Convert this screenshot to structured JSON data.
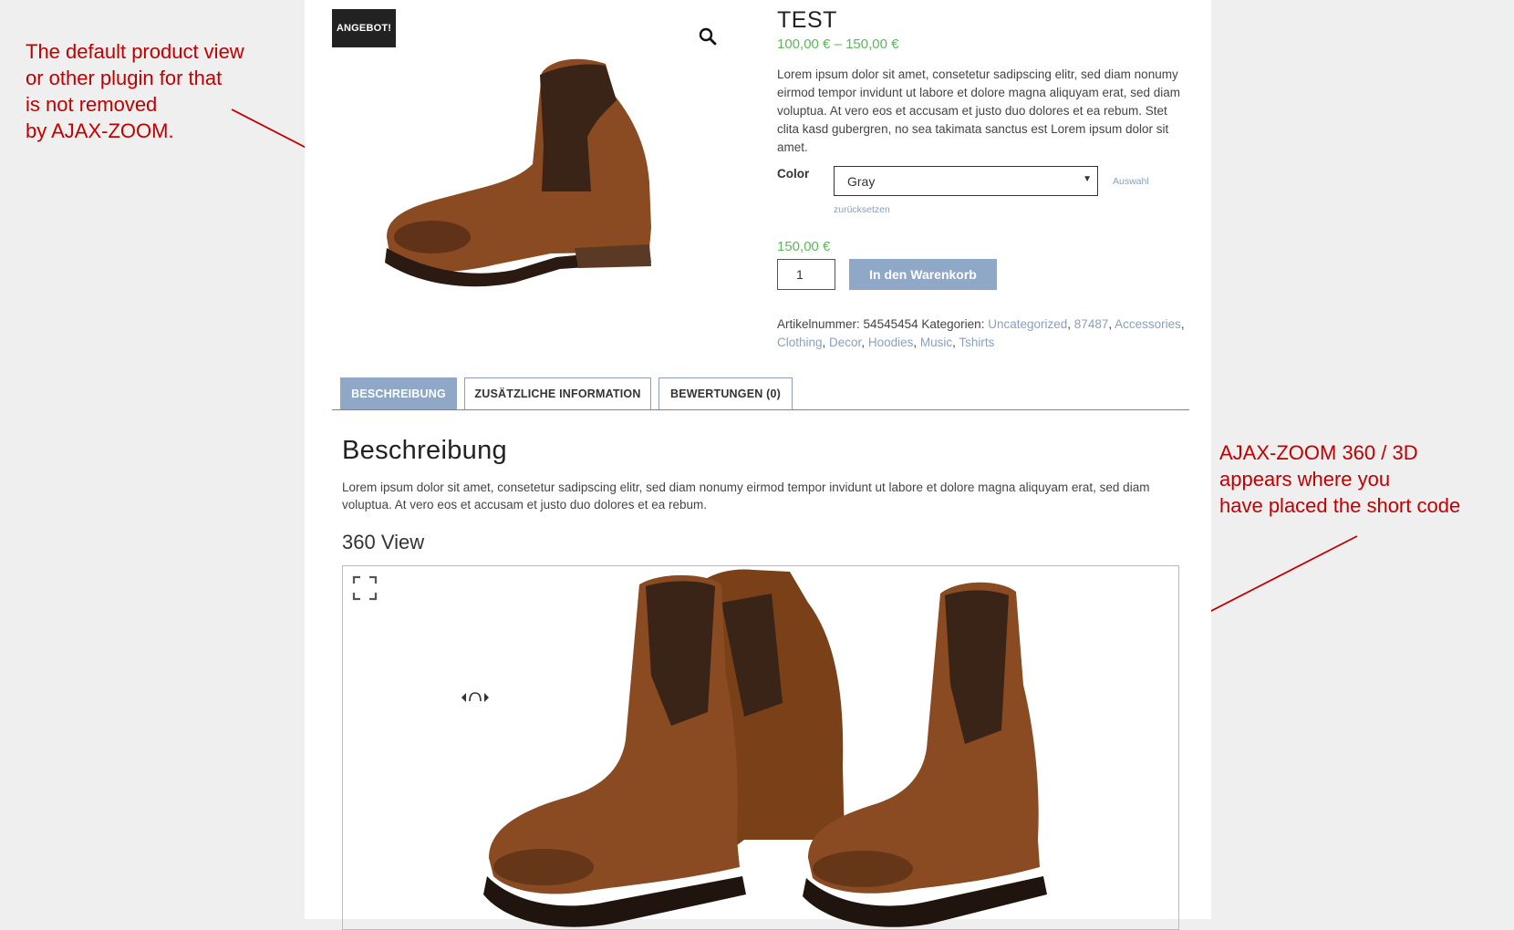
{
  "annotations": {
    "left": "The default product view\nor other plugin for that\nis not removed\nby AJAX-ZOOM.",
    "right": "AJAX-ZOOM 360 / 3D\nappears where you\nhave placed the short code",
    "color": "#c00000"
  },
  "gallery": {
    "sale_badge": "ANGEBOT!",
    "zoom_icon": "magnifier-icon",
    "image": "brown-chelsea-boot-single"
  },
  "product": {
    "title": "TEST",
    "price_range": "100,00 € – 150,00 €",
    "short_description": "Lorem ipsum dolor sit amet, consetetur sadipscing elitr, sed diam nonumy eirmod tempor invidunt ut labore et dolore magna aliquyam erat, sed diam voluptua. At vero eos et accusam et justo duo dolores et ea rebum. Stet clita kasd gubergren, no sea takimata sanctus est Lorem ipsum dolor sit amet.",
    "color_label": "Color",
    "color_value": "Gray",
    "reset_label_1": "Auswahl",
    "reset_label_2": "zurücksetzen",
    "price": "150,00 €",
    "quantity": "1",
    "add_to_cart": "In den Warenkorb",
    "price_color": "#5fb55a"
  },
  "meta": {
    "sku_label": "Artikelnummer:",
    "sku": "54545454",
    "categories_label": "Kategorien:",
    "categories": [
      "Uncategorized",
      "87487",
      "Accessories",
      "Clothing",
      "Decor",
      "Hoodies",
      "Music",
      "Tshirts"
    ]
  },
  "tabs": [
    {
      "label": "BESCHREIBUNG",
      "active": true
    },
    {
      "label": "ZUSÄTZLICHE INFORMATION",
      "active": false
    },
    {
      "label": "BEWERTUNGEN (0)",
      "active": false
    }
  ],
  "description": {
    "heading": "Beschreibung",
    "text": "Lorem ipsum dolor sit amet, consetetur sadipscing elitr, sed diam nonumy eirmod tempor invidunt ut labore et dolore magna aliquyam erat, sed diam voluptua. At vero eos et accusam et justo duo dolores et ea rebum.",
    "view_heading": "360 View"
  },
  "viewer": {
    "fullscreen_icon": "fullscreen-icon",
    "spin_icon": "spin-hand-icon",
    "image": "brown-chelsea-boots-pair"
  },
  "colors": {
    "accent": "#8fa8c7",
    "link": "#8aa0bd",
    "badge": "#222222"
  }
}
